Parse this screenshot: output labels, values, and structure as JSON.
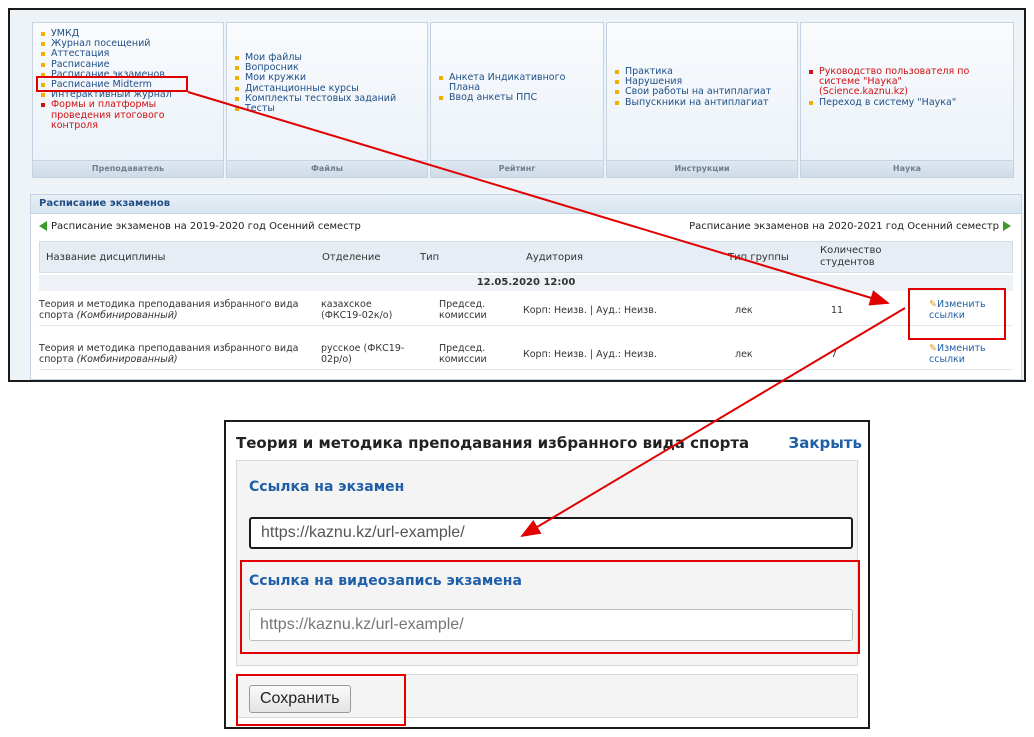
{
  "menu": {
    "panels": [
      {
        "footer": "Преподаватель",
        "items": [
          {
            "label": "УМКД",
            "style": "normal"
          },
          {
            "label": "Журнал посещений",
            "style": "normal"
          },
          {
            "label": "Аттестация",
            "style": "normal"
          },
          {
            "label": "Расписание",
            "style": "normal"
          },
          {
            "label": "Расписание экзаменов",
            "style": "normal"
          },
          {
            "label": "Расписание Midterm",
            "style": "normal"
          },
          {
            "label": "Интерактивный журнал",
            "style": "normal"
          },
          {
            "label": "Формы и платформы\nпроведения итогового\nконтроля",
            "style": "red"
          }
        ]
      },
      {
        "footer": "Файлы",
        "items": [
          {
            "label": "Мои файлы",
            "style": "normal"
          },
          {
            "label": "Вопросник",
            "style": "normal"
          },
          {
            "label": "Мои кружки",
            "style": "normal"
          },
          {
            "label": "Дистанционные курсы",
            "style": "normal"
          },
          {
            "label": "Комплекты тестовых заданий",
            "style": "normal"
          },
          {
            "label": "Тесты",
            "style": "normal"
          }
        ]
      },
      {
        "footer": "Рейтинг",
        "items": [
          {
            "label": "Анкета Индикативного\nПлана",
            "style": "normal"
          },
          {
            "label": "Ввод анкеты ППС",
            "style": "normal"
          }
        ]
      },
      {
        "footer": "Инструкции",
        "items": [
          {
            "label": "Практика",
            "style": "normal"
          },
          {
            "label": "Нарушения",
            "style": "normal"
          },
          {
            "label": "Свои работы на антиплагиат",
            "style": "normal"
          },
          {
            "label": "Выпускники на антиплагиат",
            "style": "normal"
          }
        ]
      },
      {
        "footer": "Наука",
        "items": [
          {
            "label": "Руководство пользователя по\nсистеме \"Наука\"\n(Science.kaznu.kz)",
            "style": "red"
          },
          {
            "label": "Переход в систему \"Наука\"",
            "style": "normal"
          }
        ]
      }
    ]
  },
  "exams": {
    "header": "Расписание экзаменов",
    "prev_link": "Расписание экзаменов на 2019-2020 год Осенний семестр",
    "next_link": "Расписание экзаменов на 2020-2021 год Осенний семестр",
    "columns": {
      "discipline": "Название дисциплины",
      "department": "Отделение",
      "type": "Тип",
      "room": "Аудитория",
      "group_type": "Тип группы",
      "students": "Количество\nстудентов"
    },
    "date_row": "12.05.2020 12:00",
    "rows": [
      {
        "discipline": "Теория и методика преподавания избранного вида\nспорта",
        "format": "(Комбинированный)",
        "department": "казахское\n(ФКС19-02к/о)",
        "type": "Председ.\nкомиссии",
        "room": "Корп: Неизв. | Ауд.: Неизв.",
        "group_type": "лек",
        "students": "11",
        "action": "Изменить\nссылки"
      },
      {
        "discipline": "Теория и методика преподавания избранного вида\nспорта",
        "format": "(Комбинированный)",
        "department": "русское (ФКС19-\n02р/о)",
        "type": "Председ.\nкомиссии",
        "room": "Корп: Неизв. | Ауд.: Неизв.",
        "group_type": "лек",
        "students": "7",
        "action": "Изменить\nссылки"
      }
    ]
  },
  "dialog": {
    "title": "Теория и методика преподавания избранного вида спорта",
    "close_label": "Закрыть",
    "exam_link_label": "Ссылка на экзамен",
    "exam_link_value": "https://kaznu.kz/url-example/",
    "video_link_label": "Ссылка на видеозапись экзамена",
    "video_link_placeholder": "https://kaznu.kz/url-example/",
    "save_label": "Сохранить"
  },
  "colors": {
    "annotation": "#e00000",
    "link": "#1f5fa8",
    "accent_bullet": "#f0b000"
  }
}
